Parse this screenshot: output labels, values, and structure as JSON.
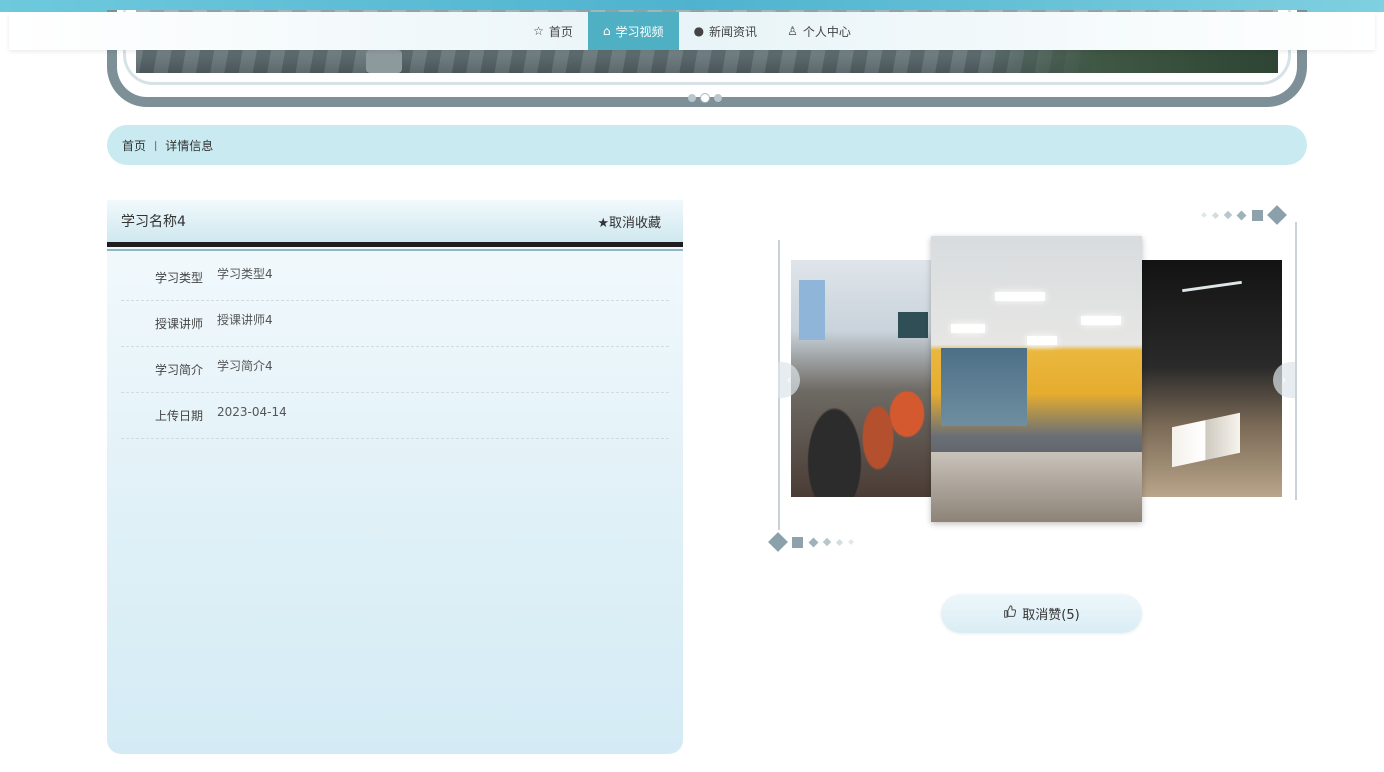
{
  "nav": {
    "items": [
      {
        "label": "首页",
        "icon": "star-outline-icon",
        "active": false
      },
      {
        "label": "学习视频",
        "icon": "home-icon",
        "active": true
      },
      {
        "label": "新闻资讯",
        "icon": "info-circle-icon",
        "active": false
      },
      {
        "label": "个人中心",
        "icon": "user-icon",
        "active": false
      }
    ]
  },
  "breadcrumb": {
    "home": "首页",
    "separator": "ǀ",
    "current": "详情信息"
  },
  "detail": {
    "title": "学习名称4",
    "favorite_label": "★取消收藏",
    "fields": [
      {
        "label": "学习类型",
        "value": "学习类型4"
      },
      {
        "label": "授课讲师",
        "value": "授课讲师4"
      },
      {
        "label": "学习简介",
        "value": "学习简介4"
      },
      {
        "label": "上传日期",
        "value": "2023-04-14"
      }
    ]
  },
  "carousel": {
    "prev_icon": "‹",
    "next_icon": "›"
  },
  "like": {
    "icon": "thumbs-up-icon",
    "label": "取消赞(5)"
  },
  "colors": {
    "accent": "#4fb0c4",
    "breadcrumb_bg": "#c9eaf1",
    "frame": "#7d9097"
  }
}
